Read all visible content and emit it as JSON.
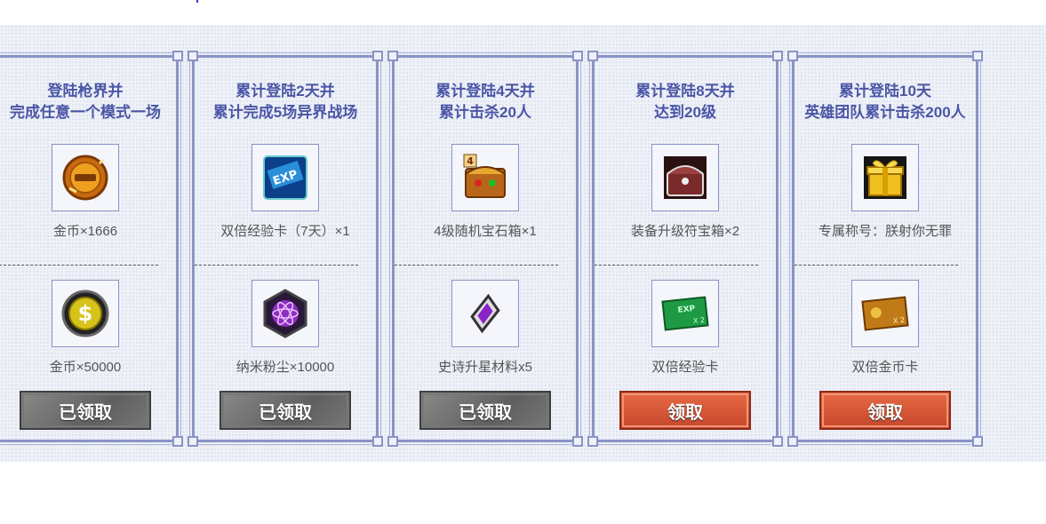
{
  "cards": [
    {
      "title_line1": "登陆枪界并",
      "title_line2": "完成任意一个模式一场",
      "reward1": "金币×1666",
      "reward2": "金币×50000",
      "button": "已领取",
      "icon1": "gold-coin-icon",
      "icon2": "dollar-chip-icon",
      "status": "claimed"
    },
    {
      "title_line1": "累计登陆2天并",
      "title_line2": "累计完成5场异界战场",
      "reward1": "双倍经验卡（7天）×1",
      "reward2": "纳米粉尘×10000",
      "button": "已领取",
      "icon1": "exp-card-icon",
      "icon2": "nano-dust-icon",
      "status": "claimed"
    },
    {
      "title_line1": "累计登陆4天并",
      "title_line2": "累计击杀20人",
      "reward1": "4级随机宝石箱×1",
      "reward2": "史诗升星材料x5",
      "button": "已领取",
      "icon1": "gem-chest-icon",
      "icon2": "purple-crystal-icon",
      "status": "claimed"
    },
    {
      "title_line1": "累计登陆8天并",
      "title_line2": "达到20级",
      "reward1": "装备升级符宝箱×2",
      "reward2": "双倍经验卡",
      "button": "领取",
      "icon1": "treasure-chest-icon",
      "icon2": "green-exp-card-icon",
      "status": "available"
    },
    {
      "title_line1": "累计登陆10天",
      "title_line2": "英雄团队累计击杀200人",
      "reward1": "专属称号：朕射你无罪",
      "reward2": "双倍金币卡",
      "button": "领取",
      "icon1": "gift-box-icon",
      "icon2": "gold-card-icon",
      "status": "available"
    }
  ],
  "colors": {
    "title": "#4a55a6",
    "border": "#8a94c6",
    "claimed_button": "#6e6e6e",
    "claim_button": "#d4553a"
  }
}
